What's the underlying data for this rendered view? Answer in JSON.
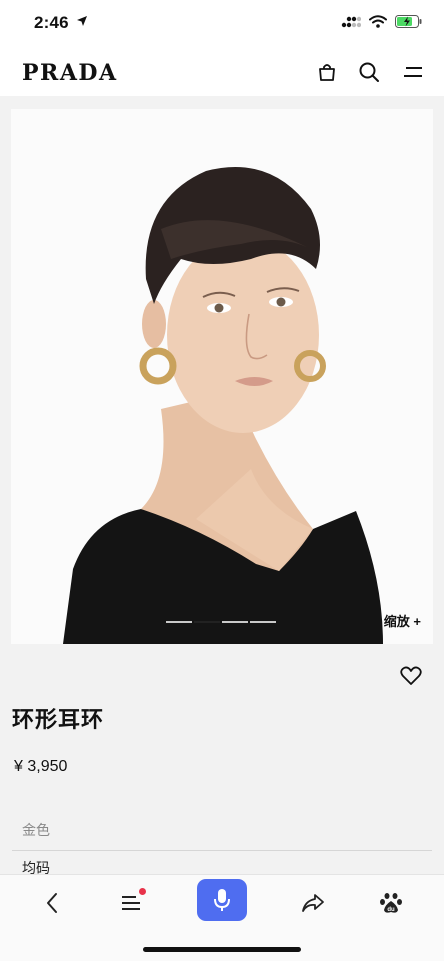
{
  "status_bar": {
    "time": "2:46",
    "location_icon": "location-arrow-icon",
    "signal_icon": "cellular-signal-icon",
    "wifi_icon": "wifi-icon",
    "battery_icon": "battery-charging-icon"
  },
  "header": {
    "logo": "PRADA",
    "bag_icon": "shopping-bag-icon",
    "search_icon": "search-icon",
    "menu_icon": "menu-icon"
  },
  "product": {
    "image_desc_icon": "product-photo",
    "zoom_label": "缩放 +",
    "carousel": {
      "count": 4,
      "active_index": 1
    },
    "wishlist_icon": "heart-icon",
    "name": "环形耳环",
    "price": "¥ 3,950",
    "color": "金色",
    "size_label": "均码"
  },
  "bottom_bar": {
    "back_icon": "chevron-left-icon",
    "tabs_icon": "menu-lines-icon",
    "voice_icon": "microphone-icon",
    "share_icon": "share-icon",
    "baidu_icon": "paw-icon",
    "accent": "#4f6df0"
  }
}
